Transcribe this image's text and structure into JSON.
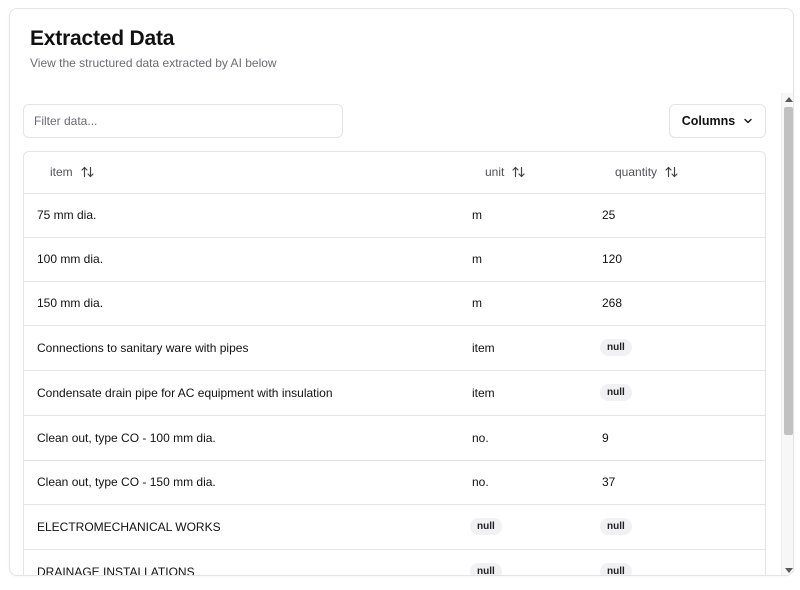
{
  "header": {
    "title": "Extracted Data",
    "subtitle": "View the structured data extracted by AI below"
  },
  "toolbar": {
    "filter_placeholder": "Filter data...",
    "columns_label": "Columns",
    "columns_icon": "chevron-down-icon"
  },
  "table": {
    "columns": [
      {
        "label": "item",
        "sort_icon": "sort-arrows-icon"
      },
      {
        "label": "unit",
        "sort_icon": "sort-arrows-icon"
      },
      {
        "label": "quantity",
        "sort_icon": "sort-arrows-icon"
      }
    ],
    "rows": [
      {
        "item": "75 mm dia.",
        "unit": "m",
        "quantity": "25"
      },
      {
        "item": "100 mm dia.",
        "unit": "m",
        "quantity": "120"
      },
      {
        "item": "150 mm dia.",
        "unit": "m",
        "quantity": "268"
      },
      {
        "item": "Connections to sanitary ware with pipes",
        "unit": "item",
        "quantity": "null"
      },
      {
        "item": "Condensate drain pipe for AC equipment with insulation",
        "unit": "item",
        "quantity": "null"
      },
      {
        "item": "Clean out, type CO - 100 mm dia.",
        "unit": "no.",
        "quantity": "9"
      },
      {
        "item": "Clean out, type CO - 150 mm dia.",
        "unit": "no.",
        "quantity": "37"
      },
      {
        "item": "ELECTROMECHANICAL WORKS",
        "unit": "null",
        "quantity": "null"
      },
      {
        "item": "DRAINAGE INSTALLATIONS",
        "unit": "null",
        "quantity": "null"
      }
    ]
  },
  "colors": {
    "border": "#e4e4e7",
    "muted_text": "#6b6b73",
    "badge_bg": "#f1f1f3"
  }
}
